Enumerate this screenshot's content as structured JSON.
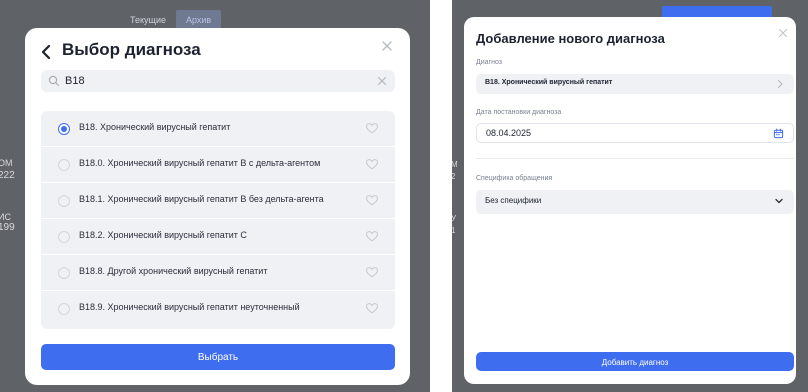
{
  "left_background": {
    "tabs": [
      "Текущие",
      "Архив"
    ],
    "fragments": [
      "ОМ",
      "222",
      "ИС",
      "199"
    ]
  },
  "diagnosis_picker": {
    "title": "Выбор диагноза",
    "search": {
      "value": "B18",
      "icon": "search-icon"
    },
    "items": [
      {
        "label": "B18. Хронический вирусный гепатит",
        "selected": true
      },
      {
        "label": "B18.0. Хронический вирусный гепатит B с дельта-агентом",
        "selected": false
      },
      {
        "label": "B18.1. Хронический вирусный гепатит B без дельта-агента",
        "selected": false
      },
      {
        "label": "B18.2. Хронический вирусный гепатит C",
        "selected": false
      },
      {
        "label": "B18.8. Другой хронический вирусный гепатит",
        "selected": false
      },
      {
        "label": "B18.9. Хронический вирусный гепатит неуточненный",
        "selected": false
      }
    ],
    "select_button": "Выбрать"
  },
  "right_background": {
    "fragments": [
      "М",
      "2",
      "У",
      "1"
    ]
  },
  "add_diagnosis": {
    "title": "Добавление нового диагноза",
    "diagnosis_label": "Диагноз",
    "diagnosis_value": "B18. Хронический вирусный гепатит",
    "date_label": "Дата постановки диагноза",
    "date_value": "08.04.2025",
    "specifics_label": "Специфика обращения",
    "specifics_value": "Без специфики",
    "add_button": "Добавить диагноз"
  },
  "colors": {
    "accent": "#3f6df0",
    "overlay": "#5f6267",
    "field_bg": "#f0f1f5"
  }
}
